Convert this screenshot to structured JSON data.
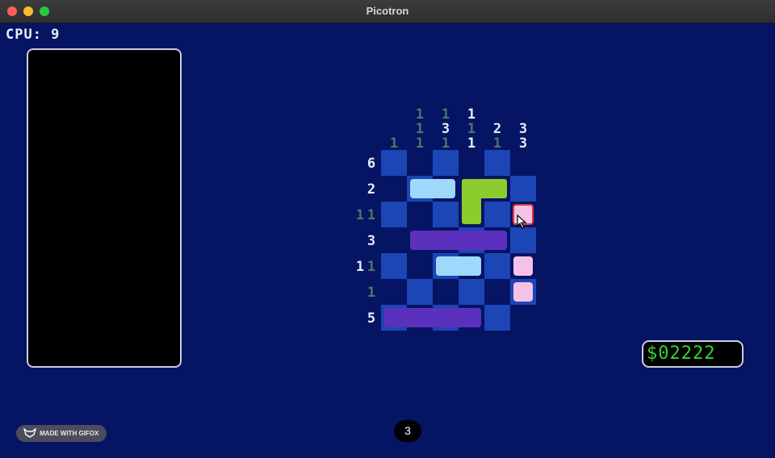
{
  "window": {
    "title": "Picotron"
  },
  "hud": {
    "cpu_text": "CPU: 9",
    "money": "$02222"
  },
  "puzzle": {
    "column_clues": [
      [
        "1"
      ],
      [
        "1",
        "1",
        "1"
      ],
      [
        "1",
        "3",
        "1"
      ],
      [
        "1",
        "1",
        "1"
      ],
      [
        "2",
        "1"
      ],
      [
        "3",
        "3"
      ]
    ],
    "row_clues": [
      [
        "6"
      ],
      [
        "2"
      ],
      [
        "1",
        "1"
      ],
      [
        "3"
      ],
      [
        "1",
        "1"
      ],
      [
        "1"
      ],
      [
        "5"
      ]
    ]
  },
  "pieces_colors": {
    "light_blue": "#9ed8fb",
    "lime": "#8ccc2c",
    "purple": "#5a30bc",
    "pink": "#f4c2e8"
  },
  "footer": {
    "badge": "MADE WITH GIFOX",
    "page": "3"
  }
}
